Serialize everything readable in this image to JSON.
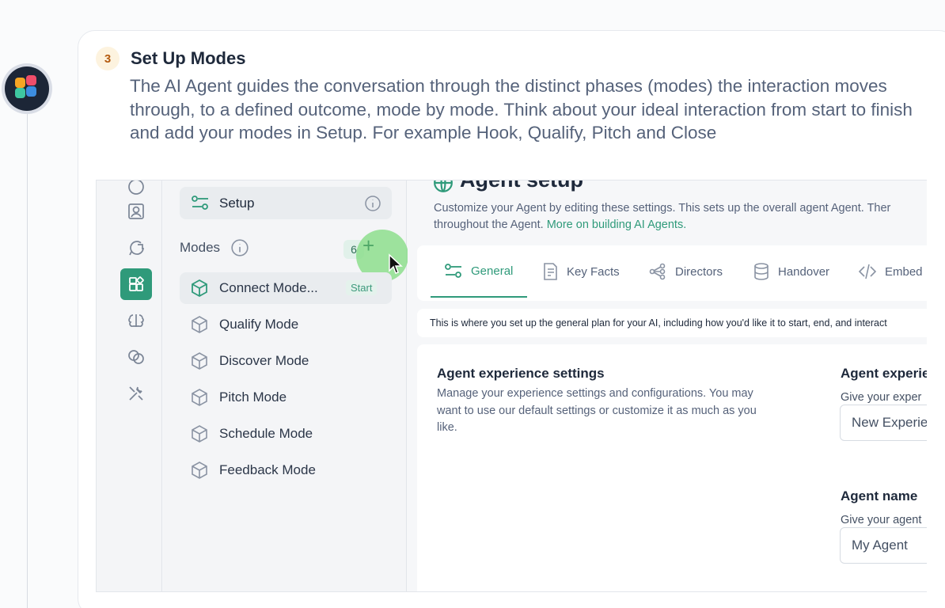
{
  "step": {
    "number": "3",
    "title": "Set Up Modes",
    "description": "The AI Agent guides the conversation through the distinct phases (modes) the interaction moves through, to a defined outcome, mode by mode. Think about your ideal interaction from start to finish and add your modes in Setup. For example Hook, Qualify, Pitch and Close"
  },
  "icons": {
    "rail": [
      "contacts-icon",
      "chat-icon",
      "modes-icon",
      "brain-icon",
      "integrations-icon",
      "tools-icon"
    ],
    "cube": "cube-icon"
  },
  "modes_panel": {
    "setup_label": "Setup",
    "modes_header": "Modes",
    "modes_count": "6",
    "modes": [
      {
        "label": "Connect Mode...",
        "badge": "Start",
        "active": true
      },
      {
        "label": "Qualify Mode"
      },
      {
        "label": "Discover Mode"
      },
      {
        "label": "Pitch Mode"
      },
      {
        "label": "Schedule Mode"
      },
      {
        "label": "Feedback Mode"
      }
    ]
  },
  "agent": {
    "title": "Agent setup",
    "desc_line1": "Customize your Agent by editing these settings. This sets up the overall agent Agent. Ther",
    "desc_line2_prefix": "throughout the Agent.",
    "desc_link": "More on building AI Agents."
  },
  "tabs": [
    "General",
    "Key Facts",
    "Directors",
    "Handover",
    "Embed"
  ],
  "info_strip": "This is where you set up the general plan for your AI, including how you'd like it to start, end, and interact",
  "settings": {
    "title": "Agent experience settings",
    "description": "Manage your experience settings and configurations. You may want to use our default settings or customize it as much as you like.",
    "exp_title": "Agent experie",
    "exp_sub": "Give your exper",
    "exp_value": "New Experie",
    "name_title": "Agent name",
    "name_sub": "Give your agent",
    "name_value": "My Agent"
  },
  "colors": {
    "accent": "#2f9a7a",
    "step_badge_bg": "#fdf3df",
    "step_badge_text": "#b45a0f"
  }
}
